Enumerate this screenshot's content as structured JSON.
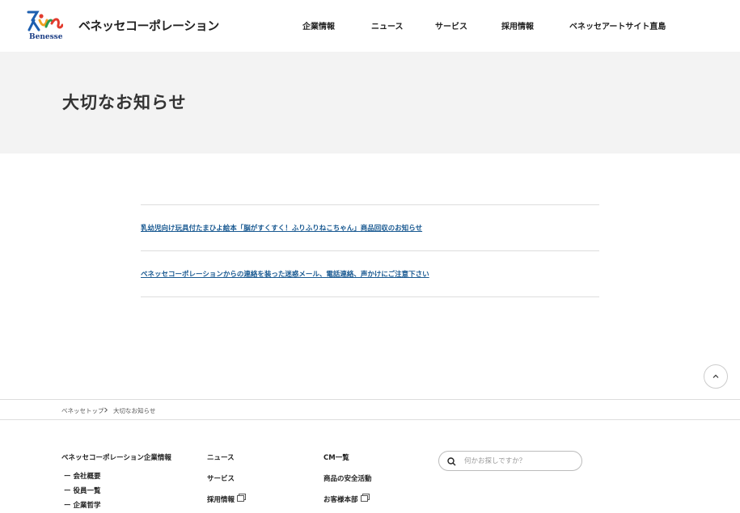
{
  "header": {
    "logo_text": "Benesse",
    "brand": "ベネッセコーポレーション",
    "nav": [
      "企業情報",
      "ニュース",
      "サービス",
      "採用情報",
      "ベネッセアートサイト直島"
    ]
  },
  "hero": {
    "title": "大切なお知らせ"
  },
  "notices": [
    "乳幼児向け玩具付たまひよ絵本「脳がすくすく！ふりふりねこちゃん」商品回収のお知らせ",
    "ベネッセコーポレーションからの連絡を装った迷惑メール、電話連絡、声かけにご注意下さい"
  ],
  "breadcrumb": {
    "home": "ベネッセトップ",
    "current": "大切なお知らせ"
  },
  "footer": {
    "col1": {
      "title": "ベネッセコーポレーション企業情報",
      "items": [
        "ー 会社概要",
        "ー 役員一覧",
        "ー 企業哲学"
      ]
    },
    "col2": [
      "ニュース",
      "サービス",
      "採用情報"
    ],
    "col3": [
      "CM一覧",
      "商品の安全活動",
      "お客様本部"
    ],
    "search_placeholder": "何かお探しですか？"
  },
  "colors": {
    "link": "#1a5a92",
    "hero_bg": "#f3f3f3"
  }
}
